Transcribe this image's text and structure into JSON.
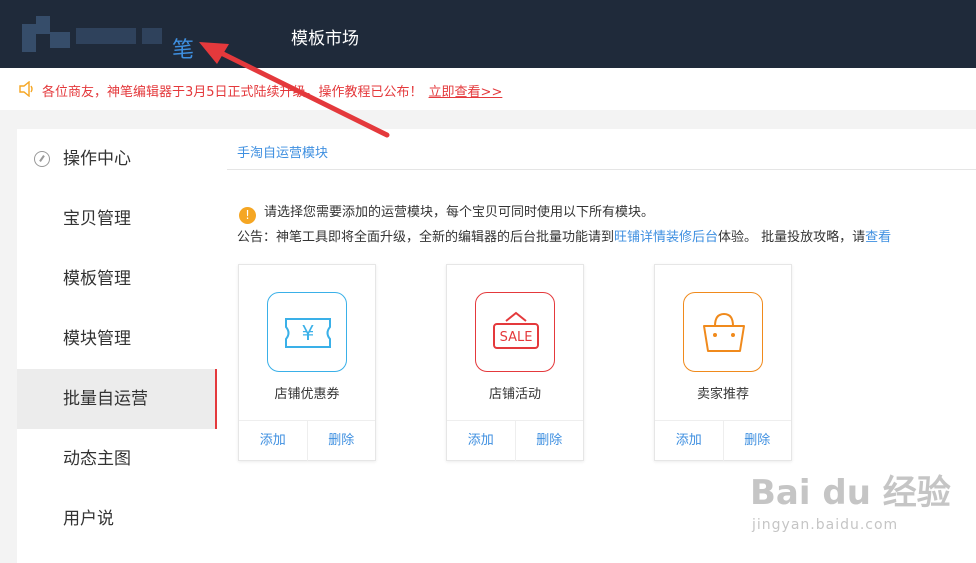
{
  "header": {
    "logo_text": "笔",
    "nav_title": "模板市场"
  },
  "notice": {
    "text": "各位商友，神笔编辑器于3月5日正式陆续升级，操作教程已公布！",
    "link": "立即查看>>"
  },
  "sidebar": {
    "items": [
      {
        "label": "操作中心"
      },
      {
        "label": "宝贝管理"
      },
      {
        "label": "模板管理"
      },
      {
        "label": "模块管理"
      },
      {
        "label": "批量自运营"
      },
      {
        "label": "动态主图"
      },
      {
        "label": "用户说"
      }
    ]
  },
  "main": {
    "section_title": "手淘自运营模块",
    "warning": "请选择您需要添加的运营模块，每个宝贝可同时使用以下所有模块。",
    "announce_prefix": "公告：神笔工具即将全面升级，全新的编辑器的后台批量功能请到",
    "announce_link": "旺铺详情装修后台",
    "announce_mid": "体验。 批量投放攻略，请",
    "announce_link2": "查看",
    "cards": [
      {
        "name": "店铺优惠券",
        "icon": "coupon-icon",
        "color": "#3ab0e8",
        "add": "添加",
        "delete": "删除"
      },
      {
        "name": "店铺活动",
        "icon": "sale-sign-icon",
        "color": "#e4393c",
        "add": "添加",
        "delete": "删除"
      },
      {
        "name": "卖家推荐",
        "icon": "shopping-bag-icon",
        "color": "#f08a1c",
        "add": "添加",
        "delete": "删除"
      }
    ]
  },
  "watermark": {
    "brand": "Bai du 经验",
    "url": "jingyan.baidu.com"
  },
  "colors": {
    "topbar": "#1f2a3a",
    "accent": "#3e8fe0",
    "notice": "#e4393c"
  }
}
